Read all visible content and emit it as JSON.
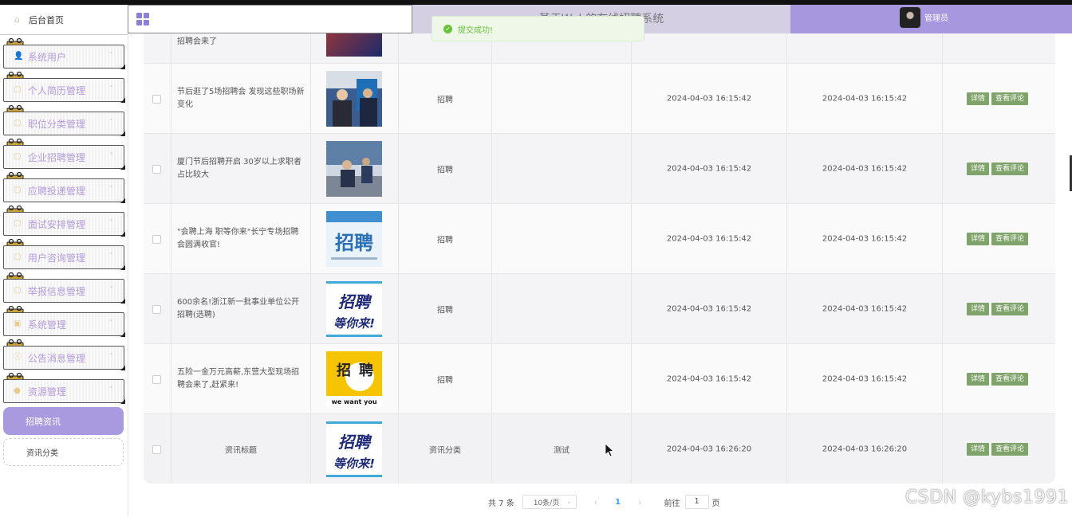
{
  "sidebar": {
    "home": "后台首页",
    "items": [
      {
        "label": "系统用户"
      },
      {
        "label": "个人简历管理"
      },
      {
        "label": "职位分类管理"
      },
      {
        "label": "企业招聘管理"
      },
      {
        "label": "应聘投递管理"
      },
      {
        "label": "面试安排管理"
      },
      {
        "label": "用户咨询管理"
      },
      {
        "label": "举报信息管理"
      },
      {
        "label": "系统管理"
      },
      {
        "label": "公告消息管理"
      },
      {
        "label": "资源管理"
      }
    ],
    "sub_items": [
      {
        "label": "招聘资讯",
        "active": true
      },
      {
        "label": "资讯分类",
        "active": false
      }
    ]
  },
  "header": {
    "title": "基于Web的在线招聘系统",
    "user": "管理员",
    "colors": {
      "accent": "#a697de",
      "title_bg": "#d4cfe3"
    }
  },
  "toast": {
    "message": "提交成功!",
    "type": "success"
  },
  "table": {
    "partial_row": {
      "title": "招聘会来了"
    },
    "rows": [
      {
        "title": "节后逛了5场招聘会 发现这些职场新变化",
        "category": "招聘",
        "content": "",
        "created": "2024-04-03 16:15:42",
        "updated": "2024-04-03 16:15:42",
        "thumb": "photo-booth"
      },
      {
        "title": "厦门节后招聘开启 30岁以上求职者占比较大",
        "category": "招聘",
        "content": "",
        "created": "2024-04-03 16:15:42",
        "updated": "2024-04-03 16:15:42",
        "thumb": "photo-desk"
      },
      {
        "title": "\"会聘上海 职等你来\"长宁专场招聘会圆满收官!",
        "category": "招聘",
        "content": "",
        "created": "2024-04-03 16:15:42",
        "updated": "2024-04-03 16:15:42",
        "thumb": "poster-3d"
      },
      {
        "title": "600余名!浙江新一批事业单位公开招聘(选聘)",
        "category": "招聘",
        "content": "",
        "created": "2024-04-03 16:15:42",
        "updated": "2024-04-03 16:15:42",
        "thumb": "poster-wait"
      },
      {
        "title": "五险一金万元高薪,东营大型现场招聘会来了,赶紧来!",
        "category": "招聘",
        "content": "",
        "created": "2024-04-03 16:15:42",
        "updated": "2024-04-03 16:15:42",
        "thumb": "poster-yellow"
      },
      {
        "title": "资讯标题",
        "category": "资讯分类",
        "content": "测试",
        "created": "2024-04-03 16:26:20",
        "updated": "2024-04-03 16:26:20",
        "thumb": "poster-wait",
        "centered": true
      }
    ],
    "actions": {
      "detail": "详情",
      "comments": "查看评论"
    }
  },
  "thumb_text": {
    "zhaopin": "招聘",
    "deng": "等你来!",
    "we_want_you": "we want you"
  },
  "pagination": {
    "total": "共 7 条",
    "page_size": "10条/页",
    "current": "1",
    "goto_label": "前往",
    "goto_value": "1",
    "page_unit": "页"
  },
  "watermark": "CSDN @kybs1991"
}
